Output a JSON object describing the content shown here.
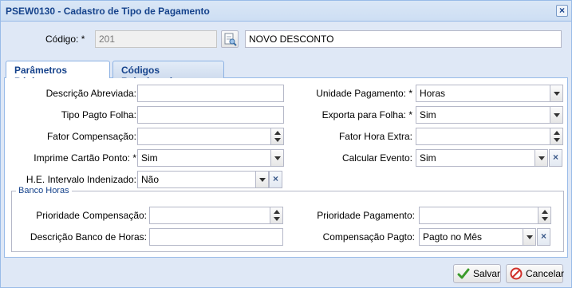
{
  "window": {
    "title": "PSEW0130 - Cadastro de Tipo de Pagamento"
  },
  "codigo": {
    "label": "Código: *",
    "value": "201",
    "description": "NOVO DESCONTO"
  },
  "tabs": [
    {
      "label": "Parâmetros Básicos",
      "active": true
    },
    {
      "label": "Códigos Relacionados",
      "active": false
    }
  ],
  "left": {
    "descricao_abreviada": {
      "label": "Descrição Abreviada:",
      "value": ""
    },
    "tipo_pagto_folha": {
      "label": "Tipo Pagto Folha:",
      "value": ""
    },
    "fator_compensacao": {
      "label": "Fator Compensação:",
      "value": ""
    },
    "imprime_cartao_ponto": {
      "label": "Imprime Cartão Ponto: *",
      "value": "Sim"
    },
    "he_intervalo_indenizado": {
      "label": "H.E. Intervalo Indenizado:",
      "value": "Não"
    }
  },
  "right": {
    "unidade_pagamento": {
      "label": "Unidade Pagamento: *",
      "value": "Horas"
    },
    "exporta_para_folha": {
      "label": "Exporta para Folha: *",
      "value": "Sim"
    },
    "fator_hora_extra": {
      "label": "Fator Hora Extra:",
      "value": ""
    },
    "calcular_evento": {
      "label": "Calcular Evento:",
      "value": "Sim"
    }
  },
  "banco_horas": {
    "legend": "Banco Horas",
    "prioridade_compensacao": {
      "label": "Prioridade Compensação:",
      "value": ""
    },
    "descricao_banco_horas": {
      "label": "Descrição Banco de Horas:",
      "value": ""
    },
    "prioridade_pagamento": {
      "label": "Prioridade Pagamento:",
      "value": ""
    },
    "compensacao_pagto": {
      "label": "Compensação Pagto:",
      "value": "Pagto no Mês"
    }
  },
  "footer": {
    "save_label": "Salvar",
    "cancel_label": "Cancelar"
  },
  "icons": {
    "close": "close-icon",
    "lookup": "lookup-icon",
    "save": "check-icon",
    "cancel": "cancel-icon"
  },
  "colors": {
    "title": "#15428b",
    "window_bg": "#dfe8f6",
    "border": "#99bbe8"
  }
}
